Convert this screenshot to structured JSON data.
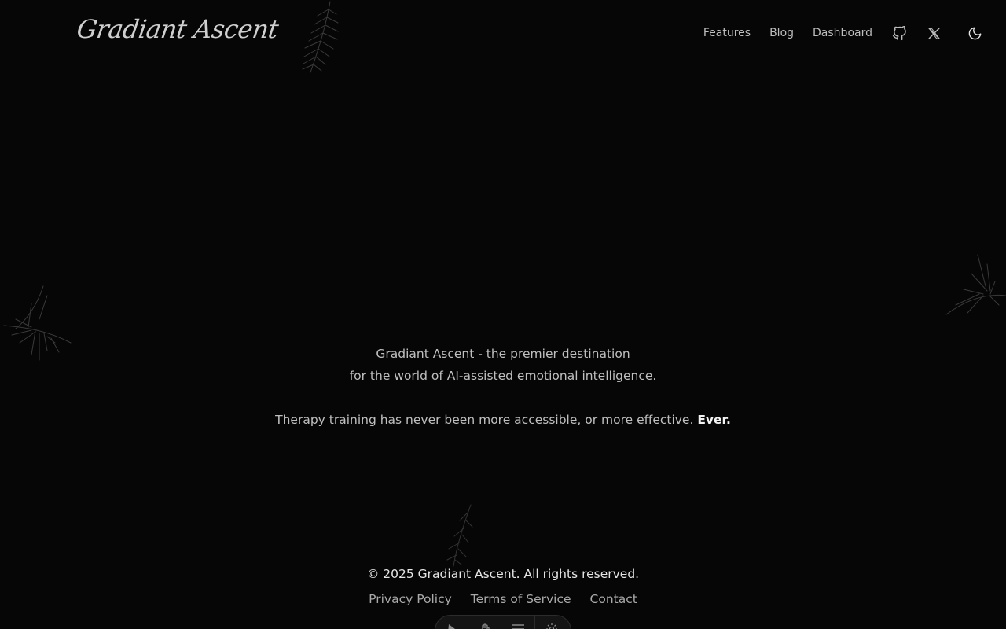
{
  "brand": {
    "name": "Gradiant Ascent"
  },
  "nav": {
    "links": [
      "Features",
      "Blog",
      "Dashboard"
    ],
    "icons": [
      "github-icon",
      "x-twitter-icon",
      "moon-icon"
    ]
  },
  "hero": {
    "line1": "Gradiant Ascent - the premier destination",
    "line2": "for the world of AI-assisted emotional intelligence.",
    "line3": "Therapy training has never been more accessible, or more effective.",
    "emphasis": "Ever."
  },
  "footer": {
    "copyright": "© 2025 Gradiant Ascent. All rights reserved.",
    "links": [
      "Privacy Policy",
      "Terms of Service",
      "Contact"
    ]
  },
  "toolbar": {
    "icons": [
      "pointer-icon",
      "hand-icon",
      "menu-icon",
      "settings-icon"
    ]
  },
  "colors": {
    "background": "#060606",
    "text": "#bfbfbf",
    "text_bright": "#f2f2f2",
    "muted": "#a9a9a9"
  }
}
